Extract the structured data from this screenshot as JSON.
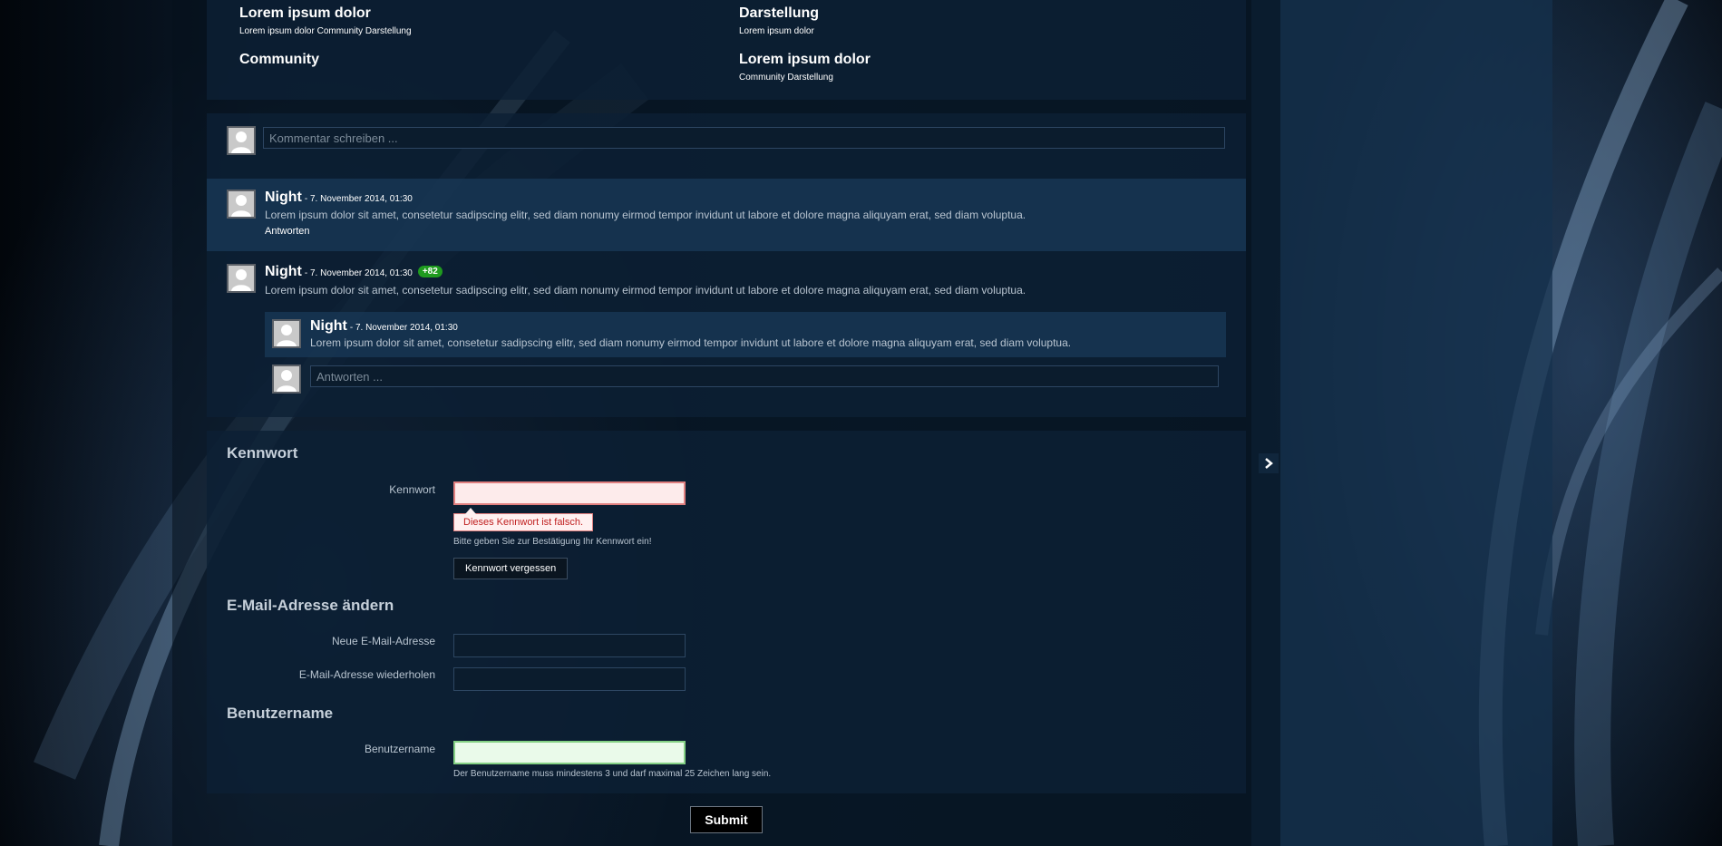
{
  "links": [
    {
      "title": "Lorem ipsum dolor",
      "sub": "Lorem ipsum dolor Community Darstellung"
    },
    {
      "title": "Darstellung",
      "sub": "Lorem ipsum dolor"
    },
    {
      "title": "Community",
      "sub": ""
    },
    {
      "title": "Lorem ipsum dolor",
      "sub": "Community Darstellung"
    }
  ],
  "comment_placeholder": "Kommentar schreiben ...",
  "comments": [
    {
      "author": "Night",
      "date": "- 7. November 2014, 01:30",
      "text": "Lorem ipsum dolor sit amet, consetetur sadipscing elitr, sed diam nonumy eirmod tempor invidunt ut labore et dolore magna aliquyam erat, sed diam voluptua.",
      "reply": "Antworten"
    },
    {
      "author": "Night",
      "date": "- 7. November 2014, 01:30",
      "badge": "+82",
      "text": "Lorem ipsum dolor sit amet, consetetur sadipscing elitr, sed diam nonumy eirmod tempor invidunt ut labore et dolore magna aliquyam erat, sed diam voluptua."
    },
    {
      "author": "Night",
      "date": "- 7. November 2014, 01:30",
      "text": "Lorem ipsum dolor sit amet, consetetur sadipscing elitr, sed diam nonumy eirmod tempor invidunt ut labore et dolore magna aliquyam erat, sed diam voluptua."
    }
  ],
  "reply_placeholder": "Antworten ...",
  "form": {
    "password_section": "Kennwort",
    "password_label": "Kennwort",
    "password_error": "Dieses Kennwort ist falsch.",
    "password_hint": "Bitte geben Sie zur Bestätigung Ihr Kennwort ein!",
    "forgot_button": "Kennwort vergessen",
    "email_section": "E-Mail-Adresse ändern",
    "email_new_label": "Neue E-Mail-Adresse",
    "email_repeat_label": "E-Mail-Adresse wiederholen",
    "username_section": "Benutzername",
    "username_label": "Benutzername",
    "username_hint": "Der Benutzername muss mindestens 3 und darf maximal 25 Zeichen lang sein.",
    "submit": "Submit"
  }
}
